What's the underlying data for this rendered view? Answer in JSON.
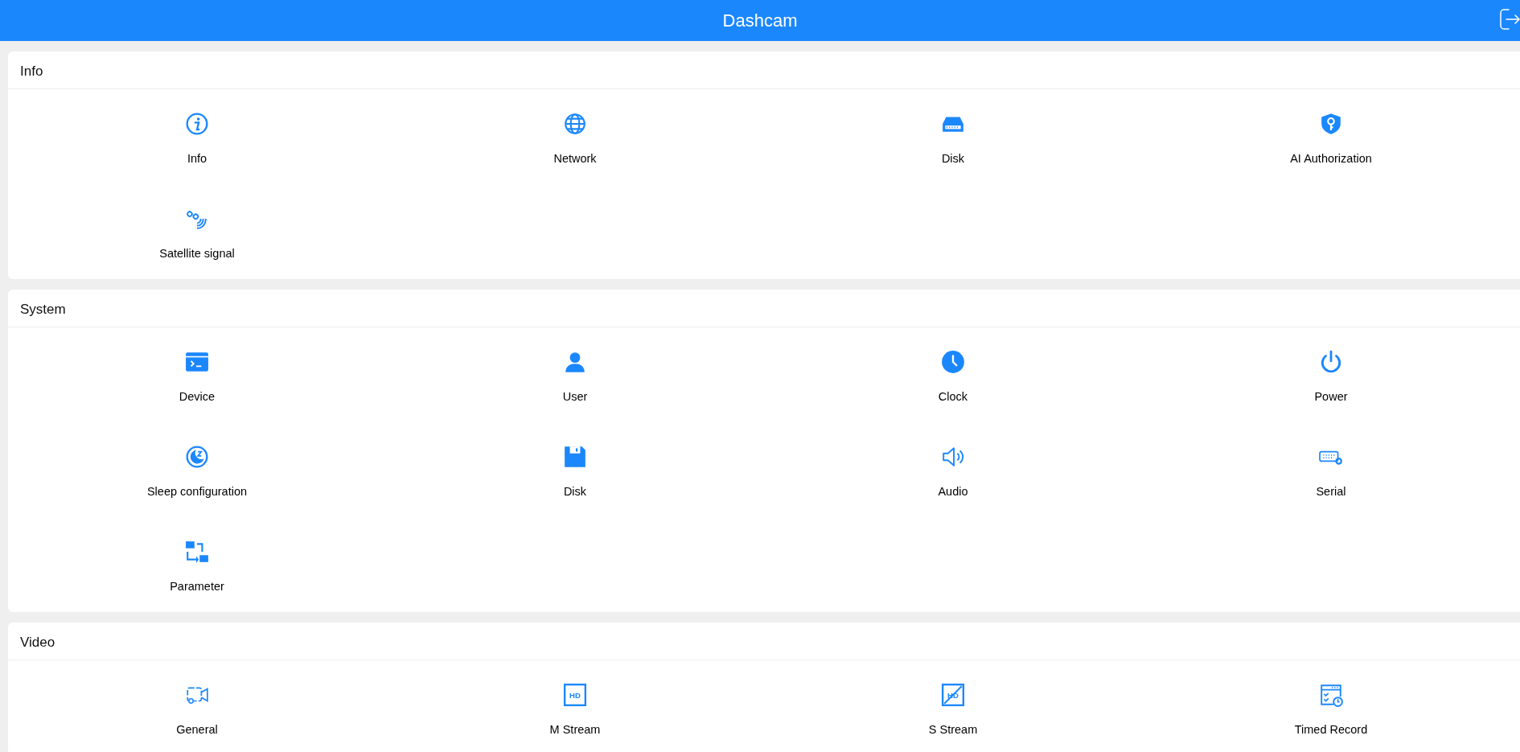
{
  "header": {
    "title": "Dashcam"
  },
  "sections": [
    {
      "title": "Info",
      "items": [
        {
          "label": "Info",
          "kind": "info"
        },
        {
          "label": "Network",
          "kind": "globe"
        },
        {
          "label": "Disk",
          "kind": "harddisk"
        },
        {
          "label": "AI Authorization",
          "kind": "shield"
        },
        {
          "label": "Satellite signal",
          "kind": "satellite"
        }
      ]
    },
    {
      "title": "System",
      "items": [
        {
          "label": "Device",
          "kind": "terminal"
        },
        {
          "label": "User",
          "kind": "user"
        },
        {
          "label": "Clock",
          "kind": "clock"
        },
        {
          "label": "Power",
          "kind": "power"
        },
        {
          "label": "Sleep configuration",
          "kind": "sleep"
        },
        {
          "label": "Disk",
          "kind": "floppy"
        },
        {
          "label": "Audio",
          "kind": "speaker"
        },
        {
          "label": "Serial",
          "kind": "serial"
        },
        {
          "label": "Parameter",
          "kind": "swap"
        }
      ]
    },
    {
      "title": "Video",
      "items": [
        {
          "label": "General",
          "kind": "camera"
        },
        {
          "label": "M Stream",
          "kind": "hd",
          "icon_text": "HD"
        },
        {
          "label": "S Stream",
          "kind": "hdoff",
          "icon_text": "HD"
        },
        {
          "label": "Timed Record",
          "kind": "schedule"
        }
      ]
    }
  ]
}
